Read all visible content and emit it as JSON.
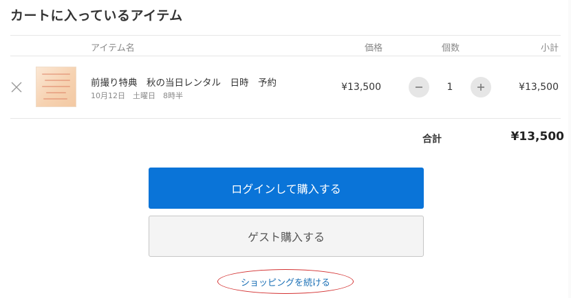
{
  "cart": {
    "title": "カートに入っているアイテム",
    "columns": {
      "item_name": "アイテム名",
      "price": "価格",
      "quantity": "個数",
      "subtotal": "小計"
    },
    "items": [
      {
        "name": "前撮り特典　秋の当日レンタル　日時　予約",
        "details": "10月12日　土曜日　8時半",
        "price": "¥13,500",
        "quantity": "1",
        "subtotal": "¥13,500"
      }
    ],
    "total_label": "合計",
    "total_value": "¥13,500"
  },
  "actions": {
    "login_purchase": "ログインして購入する",
    "guest_purchase": "ゲスト購入する",
    "continue_shopping": "ショッピングを続ける"
  },
  "icons": {
    "remove": "close-icon",
    "decrease": "minus-icon",
    "increase": "plus-icon"
  },
  "colors": {
    "primary_button": "#0a74d8",
    "link": "#1a6fb5",
    "highlight_circle": "#d32f2f"
  }
}
